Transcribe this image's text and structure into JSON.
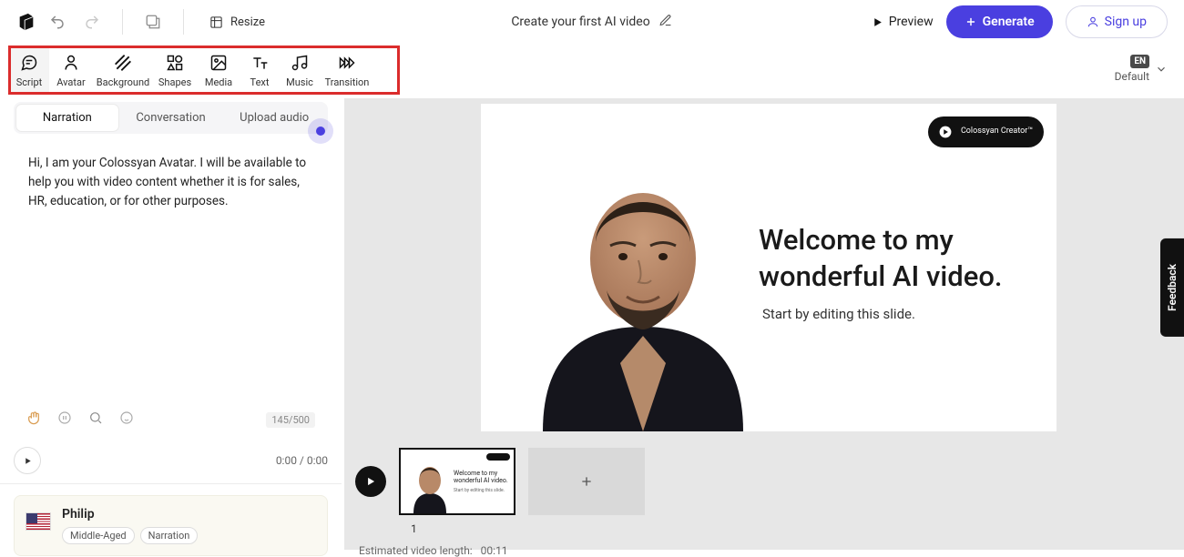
{
  "topbar": {
    "resize": "Resize",
    "title": "Create your first AI video",
    "preview": "Preview",
    "generate": "Generate",
    "signup": "Sign up"
  },
  "toolbar": {
    "items": [
      {
        "label": "Script"
      },
      {
        "label": "Avatar"
      },
      {
        "label": "Background"
      },
      {
        "label": "Shapes"
      },
      {
        "label": "Media"
      },
      {
        "label": "Text"
      },
      {
        "label": "Music"
      },
      {
        "label": "Transition"
      }
    ]
  },
  "lang": {
    "badge": "EN",
    "name": "Default"
  },
  "tabs": {
    "items": [
      {
        "label": "Narration"
      },
      {
        "label": "Conversation"
      },
      {
        "label": "Upload audio"
      }
    ]
  },
  "script": {
    "text": "Hi, I am your Colossyan Avatar. I will be available to help you with video content whether it is for sales, HR, education, or for other purposes.",
    "counter": "145/500"
  },
  "playback": {
    "time": "0:00 / 0:00"
  },
  "avatar": {
    "name": "Philip",
    "chips": [
      "Middle-Aged",
      "Narration"
    ]
  },
  "slide": {
    "brand": "Colossyan Creator™",
    "heading": "Welcome to my wonderful AI video.",
    "sub": "Start by editing this slide."
  },
  "thumbs": {
    "first_number": "1",
    "mini_heading": "Welcome to my wonderful AI video.",
    "mini_sub": "Start by editing this slide."
  },
  "footer": {
    "est_label": "Estimated video length:",
    "est_value": "00:11"
  },
  "feedback": "Feedback"
}
